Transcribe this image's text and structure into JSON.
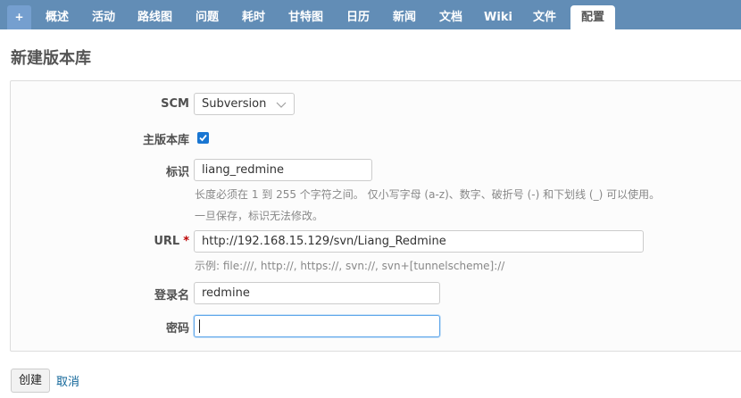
{
  "tabs": [
    {
      "label": "+"
    },
    {
      "label": "概述"
    },
    {
      "label": "活动"
    },
    {
      "label": "路线图"
    },
    {
      "label": "问题"
    },
    {
      "label": "耗时"
    },
    {
      "label": "甘特图"
    },
    {
      "label": "日历"
    },
    {
      "label": "新闻"
    },
    {
      "label": "文档"
    },
    {
      "label": "Wiki"
    },
    {
      "label": "文件"
    },
    {
      "label": "配置"
    }
  ],
  "page_title": "新建版本库",
  "form": {
    "scm": {
      "label": "SCM",
      "value": "Subversion"
    },
    "main_repo": {
      "label": "主版本库",
      "checked": true
    },
    "identifier": {
      "label": "标识",
      "value": "liang_redmine",
      "hint1": "长度必须在 1 到 255 个字符之间。 仅小写字母 (a-z)、数字、破折号 (-) 和下划线 (_) 可以使用。",
      "hint2": "一旦保存，标识无法修改。"
    },
    "url": {
      "label": "URL",
      "required_mark": "*",
      "value": "http://192.168.15.129/svn/Liang_Redmine",
      "hint": "示例: file:///, http://, https://, svn://, svn+[tunnelscheme]://"
    },
    "login": {
      "label": "登录名",
      "value": "redmine"
    },
    "password": {
      "label": "密码",
      "value": ""
    }
  },
  "actions": {
    "create": "创建",
    "cancel": "取消"
  },
  "colors": {
    "tabbar": "#628db6",
    "link": "#116699",
    "checkbox": "#1976d2"
  }
}
